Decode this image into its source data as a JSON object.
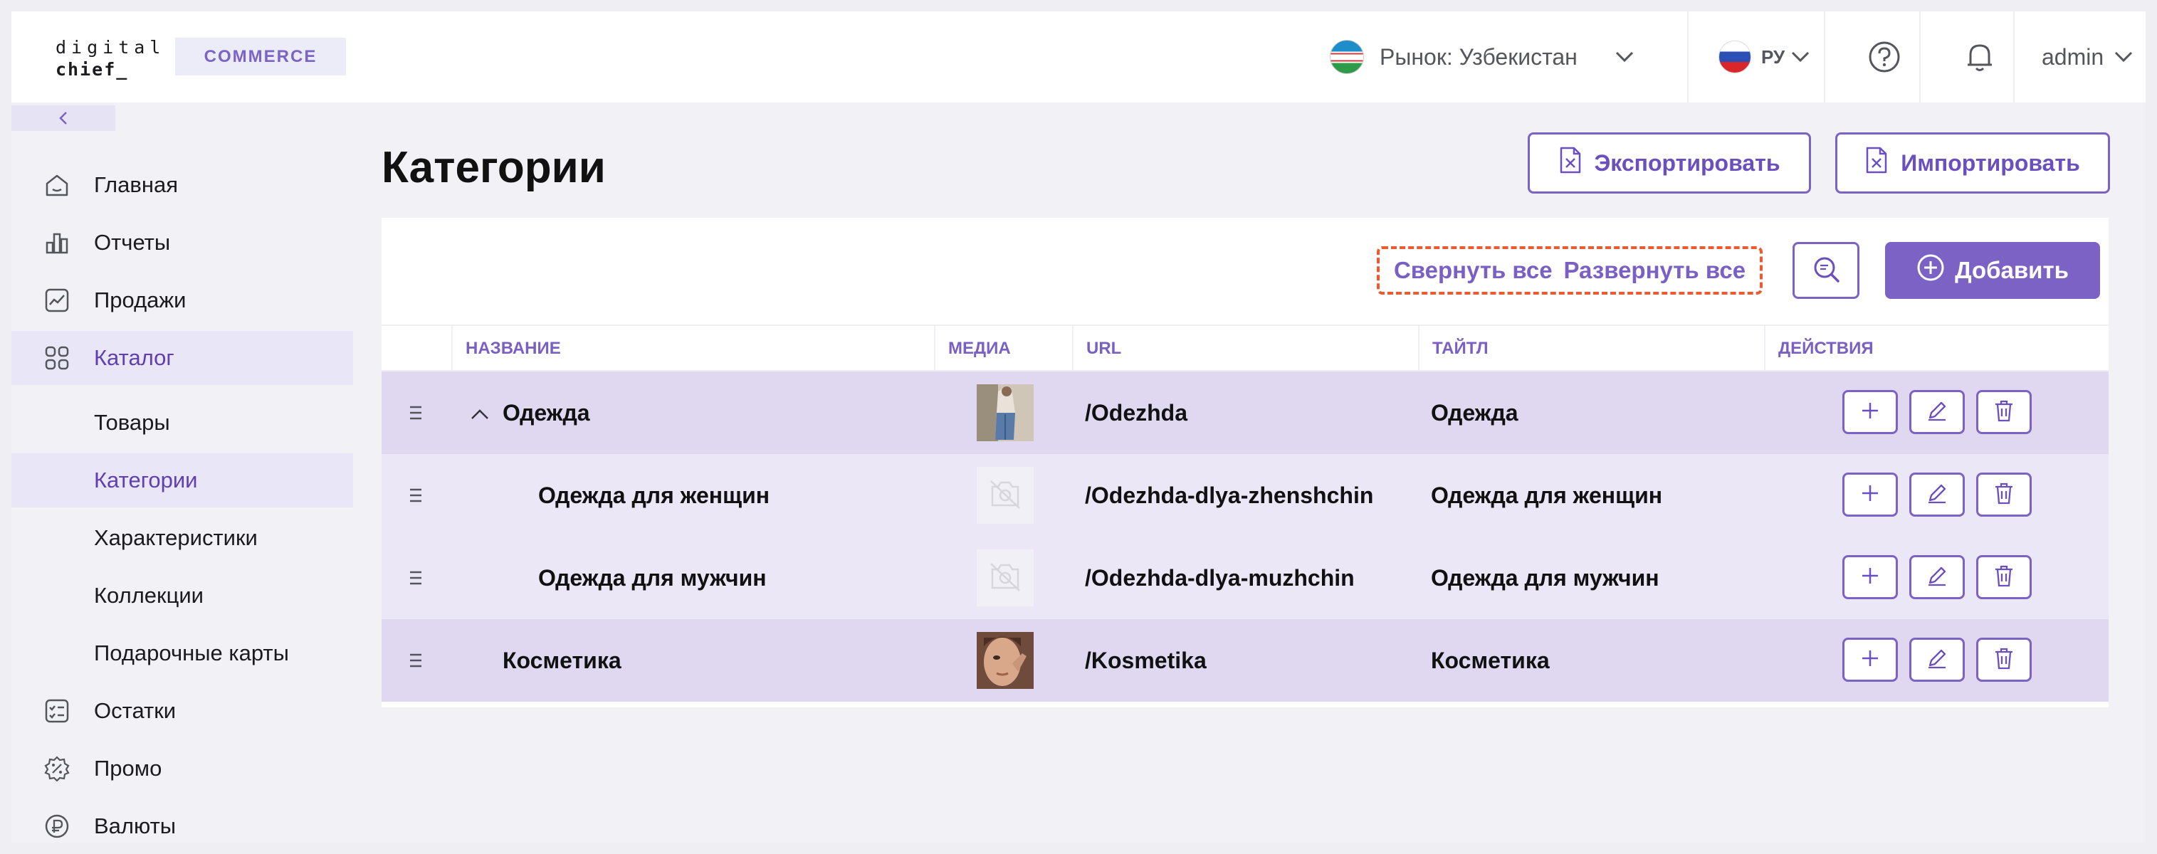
{
  "logo": {
    "line1": "digital",
    "line2": "chief_",
    "badge": "COMMERCE"
  },
  "header": {
    "market_label": "Рынок: Узбекистан",
    "language": "РУ",
    "user": "admin"
  },
  "sidebar": {
    "items": [
      {
        "label": "Главная",
        "icon": "home-icon"
      },
      {
        "label": "Отчеты",
        "icon": "reports-icon"
      },
      {
        "label": "Продажи",
        "icon": "sales-icon"
      },
      {
        "label": "Каталог",
        "icon": "catalog-icon",
        "active": true
      },
      {
        "label": "Товары",
        "sub": true
      },
      {
        "label": "Категории",
        "sub": true,
        "active": true
      },
      {
        "label": "Характеристики",
        "sub": true
      },
      {
        "label": "Коллекции",
        "sub": true
      },
      {
        "label": "Подарочные карты",
        "sub": true
      },
      {
        "label": "Остатки",
        "icon": "stock-icon"
      },
      {
        "label": "Промо",
        "icon": "promo-icon"
      },
      {
        "label": "Валюты",
        "icon": "currency-icon"
      }
    ]
  },
  "page": {
    "title": "Категории",
    "export_label": "Экспортировать",
    "import_label": "Импортировать"
  },
  "toolbar": {
    "collapse_all": "Свернуть все",
    "expand_all": "Развернуть все",
    "add_label": "Добавить"
  },
  "table": {
    "columns": [
      "НАЗВАНИЕ",
      "МЕДИА",
      "URL",
      "ТАЙТЛ",
      "ДЕЙСТВИЯ"
    ],
    "rows": [
      {
        "name": "Одежда",
        "url": "/Odezhda",
        "title": "Одежда",
        "level": 0,
        "expanded": true,
        "media": "photo"
      },
      {
        "name": "Одежда для женщин",
        "url": "/Odezhda-dlya-zhenshchin",
        "title": "Одежда для женщин",
        "level": 1,
        "media": "none"
      },
      {
        "name": "Одежда для мужчин",
        "url": "/Odezhda-dlya-muzhchin",
        "title": "Одежда для мужчин",
        "level": 1,
        "media": "none"
      },
      {
        "name": "Косметика",
        "url": "/Kosmetika",
        "title": "Косметика",
        "level": 0,
        "media": "photo"
      }
    ]
  },
  "colors": {
    "accent": "#7d62c6",
    "highlight_dash": "#ec5a32",
    "row_level0": "#e0d8f1",
    "row_level1": "#ebe7f6"
  }
}
